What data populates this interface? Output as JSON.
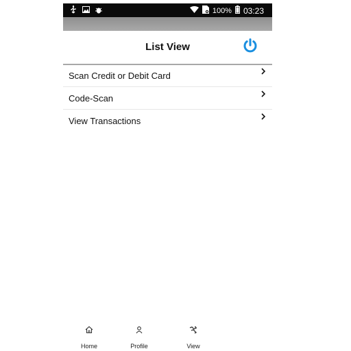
{
  "status_bar": {
    "battery": "100%",
    "time": "03:23",
    "icons": [
      "usb-icon",
      "image-icon",
      "bug-icon",
      "wifi-icon",
      "sim-icon",
      "battery-icon"
    ]
  },
  "header": {
    "title": "List View",
    "power_icon": "power-icon",
    "accent_color": "#1a8fe0"
  },
  "list": {
    "items": [
      {
        "label": "Scan Credit or Debit Card",
        "icon": "chevron-right-icon"
      },
      {
        "label": "Code-Scan",
        "icon": "chevron-right-icon"
      },
      {
        "label": "View Transactions",
        "icon": "chevron-right-icon"
      }
    ]
  },
  "bottom_nav": {
    "items": [
      {
        "label": "Home",
        "icon": "home-icon"
      },
      {
        "label": "Profile",
        "icon": "person-icon"
      },
      {
        "label": "View",
        "icon": "view-icon"
      }
    ]
  }
}
